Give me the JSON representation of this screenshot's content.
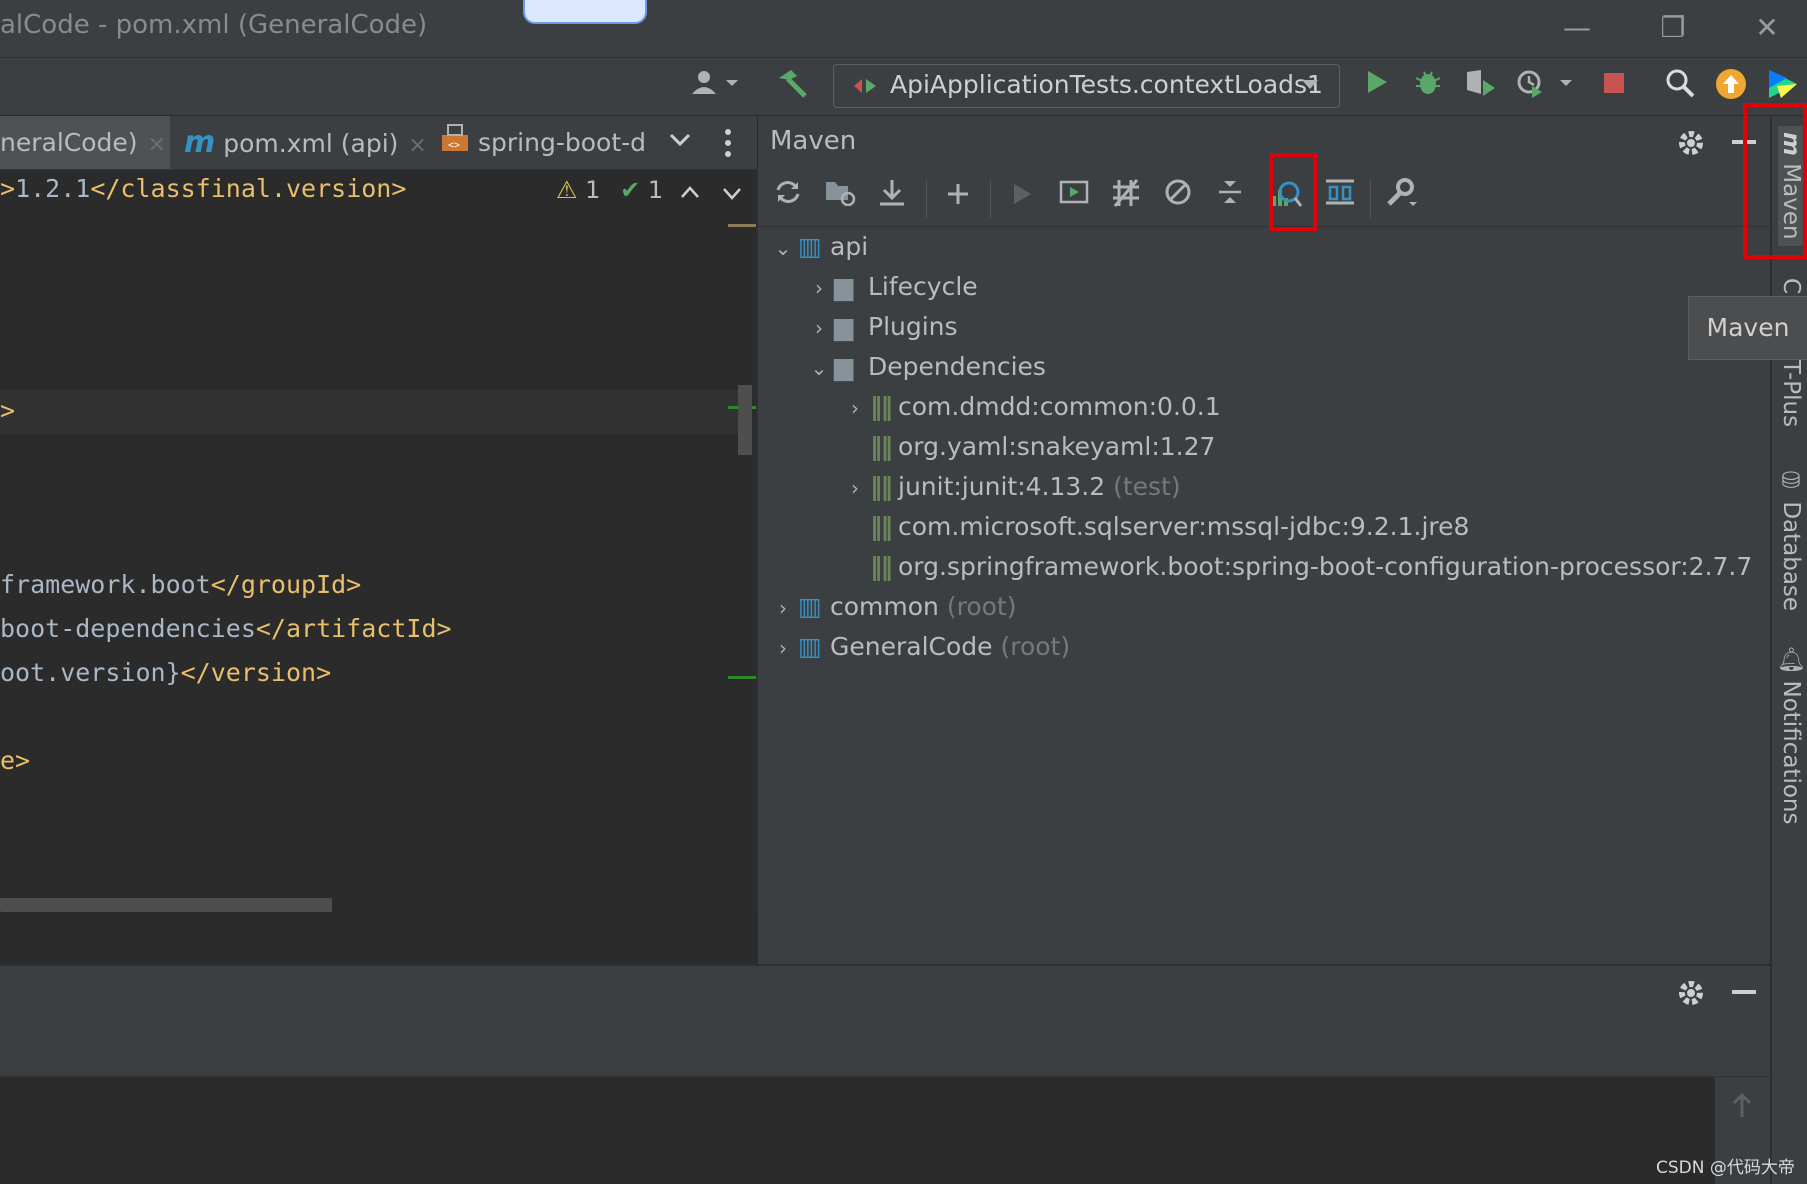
{
  "window": {
    "title": "alCode - pom.xml (GeneralCode)",
    "minimize_glyph": "—",
    "maximize_glyph": "❐",
    "close_glyph": "✕"
  },
  "toolbar": {
    "run_config": "ApiApplicationTests.contextLoads1",
    "icons": [
      "user-icon",
      "build-hammer-icon",
      "run-icon",
      "debug-icon",
      "coverage-icon",
      "profiler-icon",
      "stop-icon",
      "search-icon",
      "update-icon",
      "jetbrains-toolbox-icon"
    ]
  },
  "editor": {
    "tabs": [
      {
        "label": "neralCode)",
        "close": "×"
      },
      {
        "label": "pom.xml (api)",
        "close": "×"
      },
      {
        "label": "spring-boot-d",
        "close": ""
      }
    ],
    "inspection": {
      "warnings": "1",
      "ok": "1"
    },
    "lines": [
      {
        "tag_a": ">",
        "text": "1.2.1",
        "tag_b": "</classfinal.version>"
      },
      {
        "tag_a": ">",
        "text": "",
        "tag_b": ""
      },
      {
        "tag_a": "",
        "text": "framework.boot",
        "tag_b": "</groupId>"
      },
      {
        "tag_a": "",
        "text": "boot-dependencies",
        "tag_b": "</artifactId>"
      },
      {
        "tag_a": "",
        "text": "oot.version}",
        "tag_b": "</version>"
      },
      {
        "tag_a": "e>",
        "text": "",
        "tag_b": ""
      }
    ]
  },
  "maven": {
    "title": "Maven",
    "tree": [
      {
        "label": "api",
        "suffix": "",
        "chevron": "⌄",
        "icon": "maven-module-icon"
      },
      {
        "label": "Lifecycle",
        "suffix": "",
        "chevron": "›",
        "icon": "lifecycle-folder-icon"
      },
      {
        "label": "Plugins",
        "suffix": "",
        "chevron": "›",
        "icon": "plugins-folder-icon"
      },
      {
        "label": "Dependencies",
        "suffix": "",
        "chevron": "⌄",
        "icon": "dependencies-folder-icon"
      },
      {
        "label": "com.dmdd:common:0.0.1",
        "suffix": "",
        "chevron": "›",
        "icon": "dependency-icon"
      },
      {
        "label": "org.yaml:snakeyaml:1.27",
        "suffix": "",
        "chevron": "",
        "icon": "dependency-icon"
      },
      {
        "label": "junit:junit:4.13.2",
        "suffix": "(test)",
        "chevron": "›",
        "icon": "dependency-icon"
      },
      {
        "label": "com.microsoft.sqlserver:mssql-jdbc:9.2.1.jre8",
        "suffix": "",
        "chevron": "",
        "icon": "dependency-icon"
      },
      {
        "label": "org.springframework.boot:spring-boot-configuration-processor:2.7.7",
        "suffix": "",
        "chevron": "",
        "icon": "dependency-icon"
      },
      {
        "label": "common",
        "suffix": "(root)",
        "chevron": "›",
        "icon": "maven-module-icon"
      },
      {
        "label": "GeneralCode",
        "suffix": "(root)",
        "chevron": "›",
        "icon": "maven-module-icon"
      }
    ]
  },
  "right_stripe": {
    "maven_label": "Maven",
    "c_label": "C",
    "plus_label": "T-Plus",
    "database_label": "Database",
    "notifications_label": "Notifications"
  },
  "tooltip": "Maven",
  "watermark": "CSDN @代码大帝",
  "colors": {
    "highlight": "#e0000a",
    "tag": "#e8bf6a",
    "text": "#a9b7c6",
    "run": "#59a869",
    "stop": "#c75450",
    "update": "#f0a732"
  }
}
